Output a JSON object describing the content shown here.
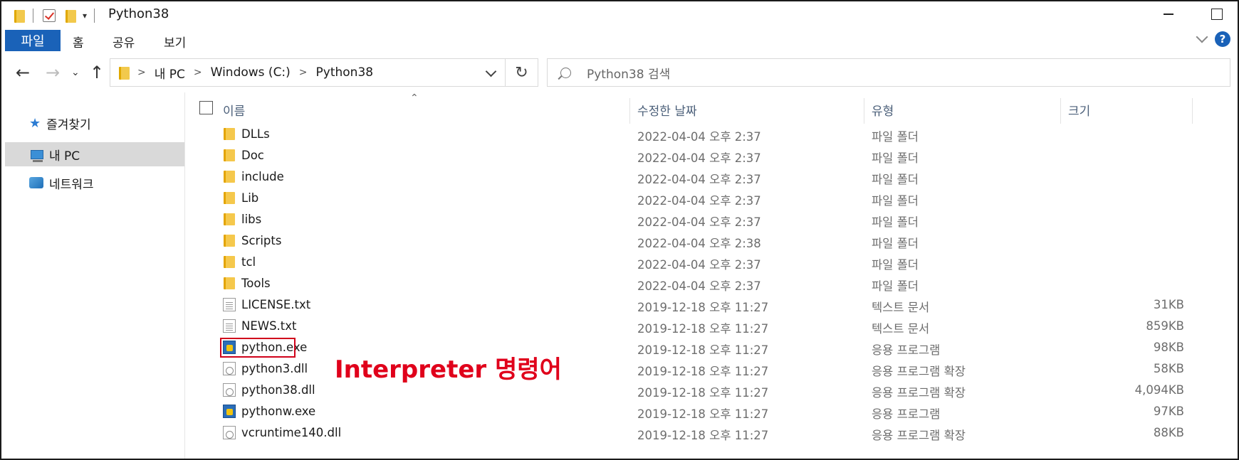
{
  "window": {
    "title": "Python38"
  },
  "ribbon": {
    "tabs": [
      "파일",
      "홈",
      "공유",
      "보기"
    ],
    "help": "?"
  },
  "address": {
    "breadcrumb": [
      "내 PC",
      "Windows (C:)",
      "Python38"
    ],
    "search_placeholder": "Python38 검색"
  },
  "nav": {
    "items": [
      {
        "label": "즐겨찾기",
        "icon": "star-icon"
      },
      {
        "label": "내 PC",
        "icon": "pc-icon"
      },
      {
        "label": "네트워크",
        "icon": "network-icon"
      }
    ]
  },
  "columns": {
    "name": "이름",
    "date": "수정한 날짜",
    "type": "유형",
    "size": "크기"
  },
  "files": [
    {
      "name": "DLLs",
      "date": "2022-04-04 오후 2:37",
      "type": "파일 폴더",
      "size": "",
      "icon": "folder"
    },
    {
      "name": "Doc",
      "date": "2022-04-04 오후 2:37",
      "type": "파일 폴더",
      "size": "",
      "icon": "folder"
    },
    {
      "name": "include",
      "date": "2022-04-04 오후 2:37",
      "type": "파일 폴더",
      "size": "",
      "icon": "folder"
    },
    {
      "name": "Lib",
      "date": "2022-04-04 오후 2:37",
      "type": "파일 폴더",
      "size": "",
      "icon": "folder"
    },
    {
      "name": "libs",
      "date": "2022-04-04 오후 2:37",
      "type": "파일 폴더",
      "size": "",
      "icon": "folder"
    },
    {
      "name": "Scripts",
      "date": "2022-04-04 오후 2:38",
      "type": "파일 폴더",
      "size": "",
      "icon": "folder"
    },
    {
      "name": "tcl",
      "date": "2022-04-04 오후 2:37",
      "type": "파일 폴더",
      "size": "",
      "icon": "folder"
    },
    {
      "name": "Tools",
      "date": "2022-04-04 오후 2:37",
      "type": "파일 폴더",
      "size": "",
      "icon": "folder"
    },
    {
      "name": "LICENSE.txt",
      "date": "2019-12-18 오후 11:27",
      "type": "텍스트 문서",
      "size": "31KB",
      "icon": "txt"
    },
    {
      "name": "NEWS.txt",
      "date": "2019-12-18 오후 11:27",
      "type": "텍스트 문서",
      "size": "859KB",
      "icon": "txt"
    },
    {
      "name": "python.exe",
      "date": "2019-12-18 오후 11:27",
      "type": "응용 프로그램",
      "size": "98KB",
      "icon": "exe"
    },
    {
      "name": "python3.dll",
      "date": "2019-12-18 오후 11:27",
      "type": "응용 프로그램 확장",
      "size": "58KB",
      "icon": "dll"
    },
    {
      "name": "python38.dll",
      "date": "2019-12-18 오후 11:27",
      "type": "응용 프로그램 확장",
      "size": "4,094KB",
      "icon": "dll"
    },
    {
      "name": "pythonw.exe",
      "date": "2019-12-18 오후 11:27",
      "type": "응용 프로그램",
      "size": "97KB",
      "icon": "exe"
    },
    {
      "name": "vcruntime140.dll",
      "date": "2019-12-18 오후 11:27",
      "type": "응용 프로그램 확장",
      "size": "88KB",
      "icon": "dll"
    }
  ],
  "annotation": {
    "text": "Interpreter 명령어",
    "color": "#e0001b"
  }
}
